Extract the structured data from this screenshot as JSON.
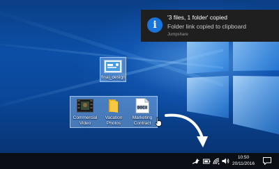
{
  "notification": {
    "title": "'3 files, 1 folder' copied",
    "body": "Folder link copied to clipboard",
    "app": "Jumpshare",
    "icon": "info-icon",
    "icon_glyph": "i",
    "accent": "#1a73d9"
  },
  "desktop": {
    "icons": [
      {
        "label": "final_design",
        "icon": "image-file-icon"
      },
      {
        "label": "Commercial Video",
        "icon": "video-file-icon"
      },
      {
        "label": "Vacation Photos",
        "icon": "folder-icon"
      },
      {
        "label": "Marketing Contract",
        "icon": "docx-file-icon"
      }
    ],
    "docx_badge": "DOCX",
    "selected_tint": "#96c3f5"
  },
  "taskbar": {
    "tray_icons": [
      "jumpshare-icon",
      "battery-icon",
      "wifi-icon",
      "volume-icon"
    ],
    "time": "10:50",
    "date": "20/11/2016",
    "action_center_icon": "notification-icon"
  }
}
